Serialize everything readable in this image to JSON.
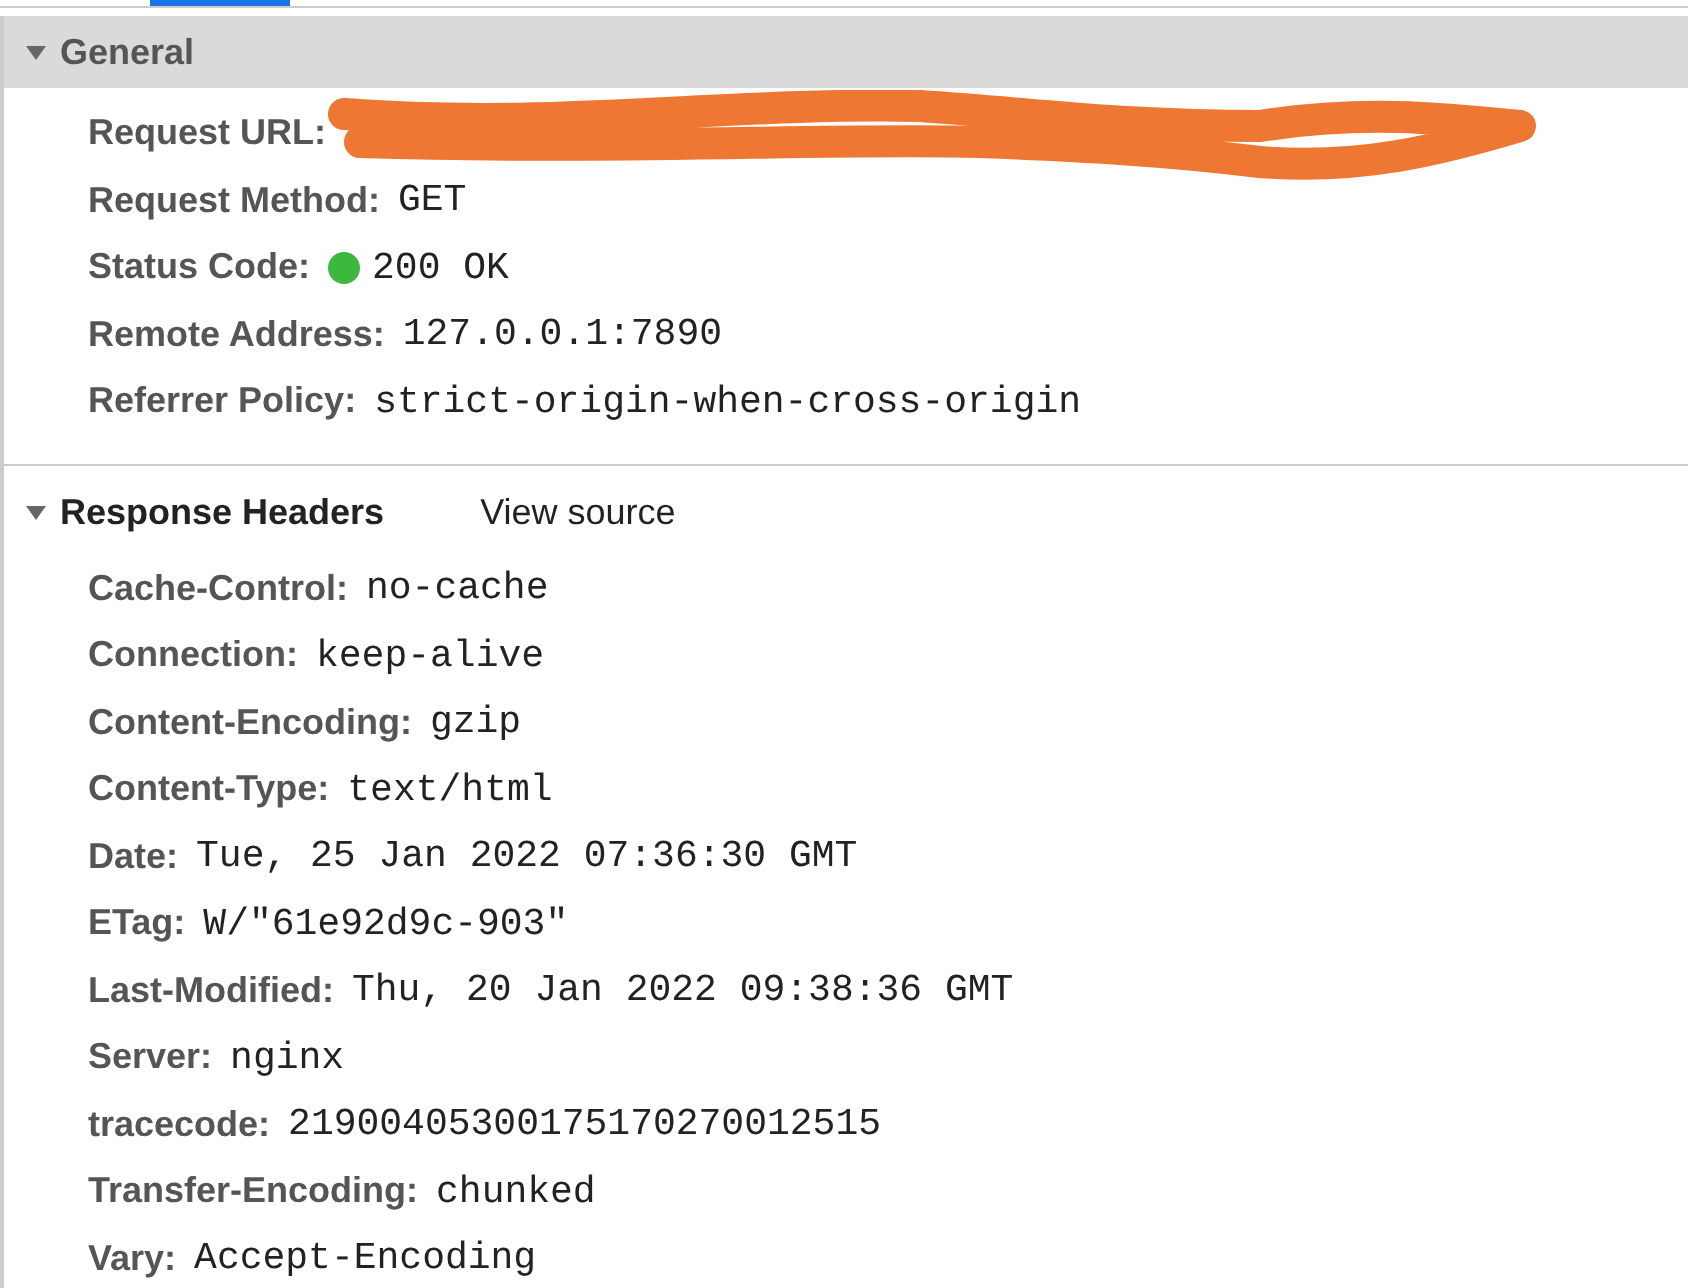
{
  "sections": [
    {
      "title": "General",
      "expanded": true,
      "kind": "general",
      "rows": [
        {
          "kind": "redacted",
          "label": "Request URL:"
        },
        {
          "kind": "text",
          "label": "Request Method:",
          "value": "GET"
        },
        {
          "kind": "status",
          "label": "Status Code:",
          "value": "200 OK",
          "color": "#3cb83c"
        },
        {
          "kind": "text",
          "label": "Remote Address:",
          "value": "127.0.0.1:7890"
        },
        {
          "kind": "text",
          "label": "Referrer Policy:",
          "value": "strict-origin-when-cross-origin"
        }
      ]
    },
    {
      "title": "Response Headers",
      "expanded": true,
      "kind": "headers",
      "link": "View source",
      "rows": [
        {
          "kind": "text",
          "label": "Cache-Control:",
          "value": "no-cache"
        },
        {
          "kind": "text",
          "label": "Connection:",
          "value": "keep-alive"
        },
        {
          "kind": "text",
          "label": "Content-Encoding:",
          "value": "gzip"
        },
        {
          "kind": "text",
          "label": "Content-Type:",
          "value": "text/html"
        },
        {
          "kind": "text",
          "label": "Date:",
          "value": "Tue, 25 Jan 2022 07:36:30 GMT"
        },
        {
          "kind": "text",
          "label": "ETag:",
          "value": "W/\"61e92d9c-903\""
        },
        {
          "kind": "text",
          "label": "Last-Modified:",
          "value": "Thu, 20 Jan 2022 09:38:36 GMT"
        },
        {
          "kind": "text",
          "label": "Server:",
          "value": "nginx"
        },
        {
          "kind": "text",
          "label": "tracecode:",
          "value": "21900405300175170270012515"
        },
        {
          "kind": "text",
          "label": "Transfer-Encoding:",
          "value": "chunked"
        },
        {
          "kind": "text",
          "label": "Vary:",
          "value": "Accept-Encoding"
        }
      ]
    }
  ]
}
